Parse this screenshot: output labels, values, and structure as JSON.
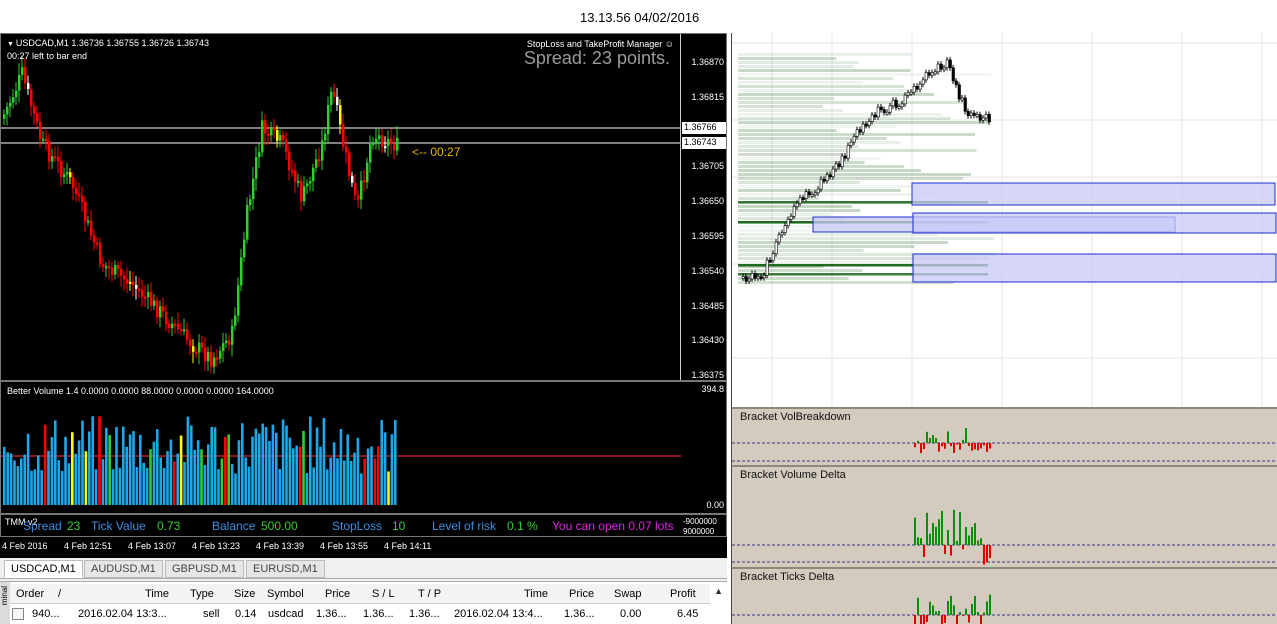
{
  "clock": "13.13.56 04/02/2016",
  "main_chart": {
    "title": "USDCAD,M1  1.36736 1.36755 1.36726 1.36743",
    "bar_timer": "00:27 left to bar end",
    "ea_name": "StopLoss and TakeProfit Manager",
    "spread_text": "Spread: 23 points.",
    "countdown": "<-- 00:27",
    "price_labels": [
      "1.36870",
      "1.36815",
      "1.36766",
      "1.36743",
      "1.36705",
      "1.36650",
      "1.36595",
      "1.36540",
      "1.36485",
      "1.36430",
      "1.36375"
    ],
    "ask_tag": "1.36766",
    "bid_tag": "1.36743"
  },
  "volume_panel": {
    "title": "Better Volume 1.4 0.0000 0.0000 88.0000 0.0000 0.0000 164.0000",
    "max_label": "394.8",
    "min_label": "0.00"
  },
  "info_bar": {
    "tmm": "TMM v2",
    "spread_label": "Spread",
    "spread_value": "23",
    "tick_label": "Tick Value",
    "tick_value": "0.73",
    "balance_label": "Balance",
    "balance_value": "500.00",
    "sl_label": "StopLoss",
    "sl_value": "10",
    "risk_label": "Level of risk",
    "risk_value": "0.1 %",
    "open_text": "You can open 0.07 lots",
    "axis_hi": "-9000000",
    "axis_lo": "9000000"
  },
  "time_axis": [
    "4 Feb 2016",
    "4 Feb 12:51",
    "4 Feb 13:07",
    "4 Feb 13:23",
    "4 Feb 13:39",
    "4 Feb 13:55",
    "4 Feb 14:11"
  ],
  "tabs": [
    "USDCAD,M1",
    "AUDUSD,M1",
    "GBPUSD,M1",
    "EURUSD,M1"
  ],
  "terminal": {
    "side_label": "minal",
    "headers": [
      "Order",
      "/",
      "Time",
      "Type",
      "Size",
      "Symbol",
      "Price",
      "S / L",
      "T / P",
      "Time",
      "Price",
      "Swap",
      "Profit"
    ],
    "row": [
      "940...",
      "2016.02.04 13:3...",
      "sell",
      "0.14",
      "usdcad",
      "1.36...",
      "1.36...",
      "1.36...",
      "2016.02.04 13:4...",
      "1.36...",
      "0.00",
      "6.45"
    ]
  },
  "bracket_panels": {
    "vol_breakdown": "Bracket VolBreakdown",
    "volume_delta": "Bracket Volume Delta",
    "ticks_delta": "Bracket Ticks Delta"
  },
  "colors": {
    "bull": "#32cd32",
    "bear": "#ff0000",
    "volume_blue": "#1ea7e8",
    "zone_fill": "#c8c8f7",
    "zone_border": "#1b2fcf",
    "profile_green": "#0a5c0a",
    "bracket_bg": "#d3cbbe"
  }
}
